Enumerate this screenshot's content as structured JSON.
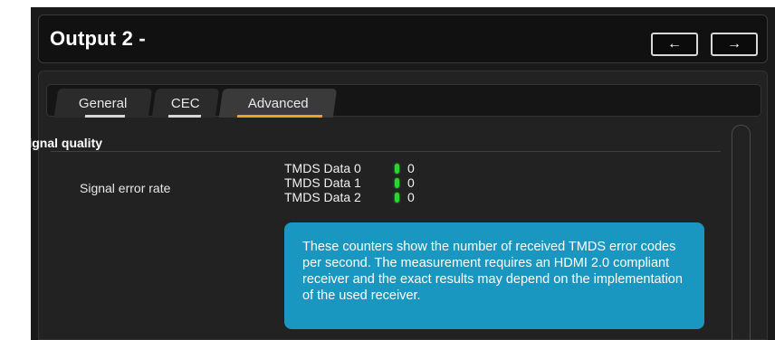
{
  "header": {
    "title": "Output 2 -",
    "prev_icon": "arrow-left-icon",
    "prev_glyph": "←",
    "next_icon": "arrow-right-icon",
    "next_glyph": "→"
  },
  "tabs": [
    {
      "label": "General",
      "active": false
    },
    {
      "label": "CEC",
      "active": false
    },
    {
      "label": "Advanced",
      "active": true
    }
  ],
  "section": {
    "title": "Signal quality",
    "row_label": "Signal error rate",
    "counters": [
      {
        "name": "TMDS Data 0",
        "value": "0",
        "status_color": "#2bd62b"
      },
      {
        "name": "TMDS Data 1",
        "value": "0",
        "status_color": "#2bd62b"
      },
      {
        "name": "TMDS Data 2",
        "value": "0",
        "status_color": "#2bd62b"
      }
    ]
  },
  "info_text": "These counters show the number of received TMDS error codes per second. The measurement requires an HDMI 2.0 compliant receiver and the exact results may depend on the implementation of the used receiver.",
  "colors": {
    "accent_tab": "#f0a020",
    "info_background": "#1a97c0",
    "background": "#1a1a1a"
  }
}
